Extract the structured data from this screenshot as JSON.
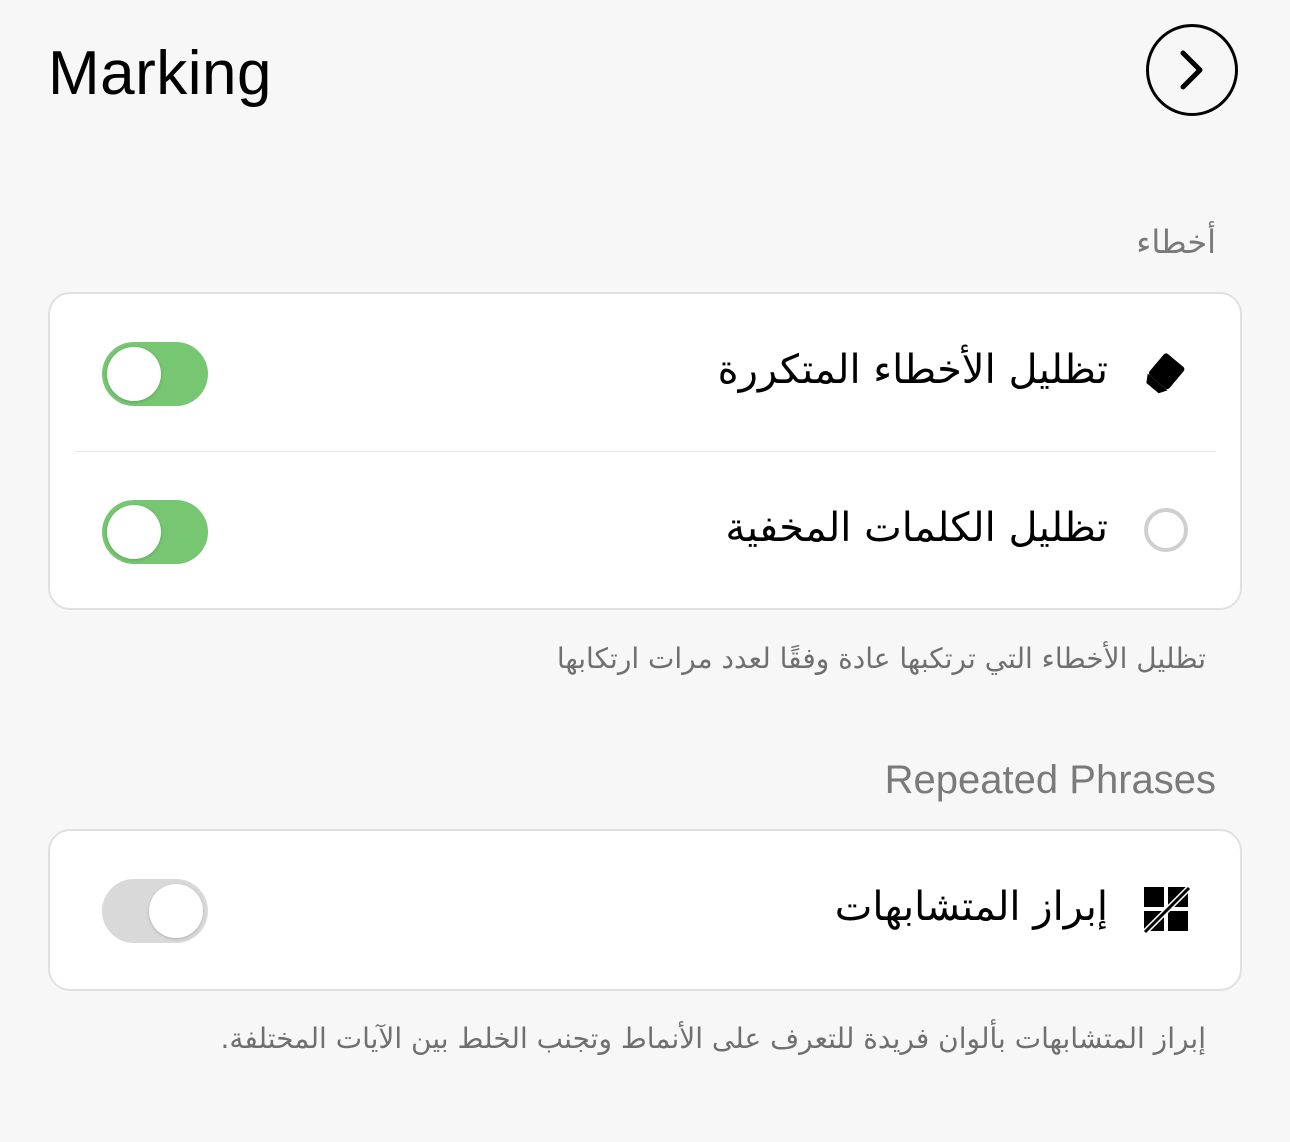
{
  "header": {
    "title": "Marking",
    "next_icon": "chevron-right-icon"
  },
  "sections": {
    "errors": {
      "title": "أخطاء",
      "items": [
        {
          "label": "تظليل الأخطاء المتكررة",
          "icon": "highlighter-icon",
          "enabled": true
        },
        {
          "label": "تظليل الكلمات المخفية",
          "icon": "circle-outline-icon",
          "enabled": true
        }
      ],
      "footnote": "تظليل الأخطاء التي ترتكبها عادة وفقًا لعدد مرات ارتكابها"
    },
    "repeated_phrases": {
      "title": "Repeated Phrases",
      "items": [
        {
          "label": "إبراز المتشابهات",
          "icon": "similar-blocks-off-icon",
          "enabled": false
        }
      ],
      "footnote": "إبراز المتشابهات بألوان فريدة للتعرف على الأنماط وتجنب الخلط بين الآيات المختلفة."
    }
  },
  "colors": {
    "background": "#f7f7f7",
    "toggle_on": "#76c672",
    "toggle_off": "#d9d9d9",
    "secondary_text": "#7a7a7a"
  }
}
